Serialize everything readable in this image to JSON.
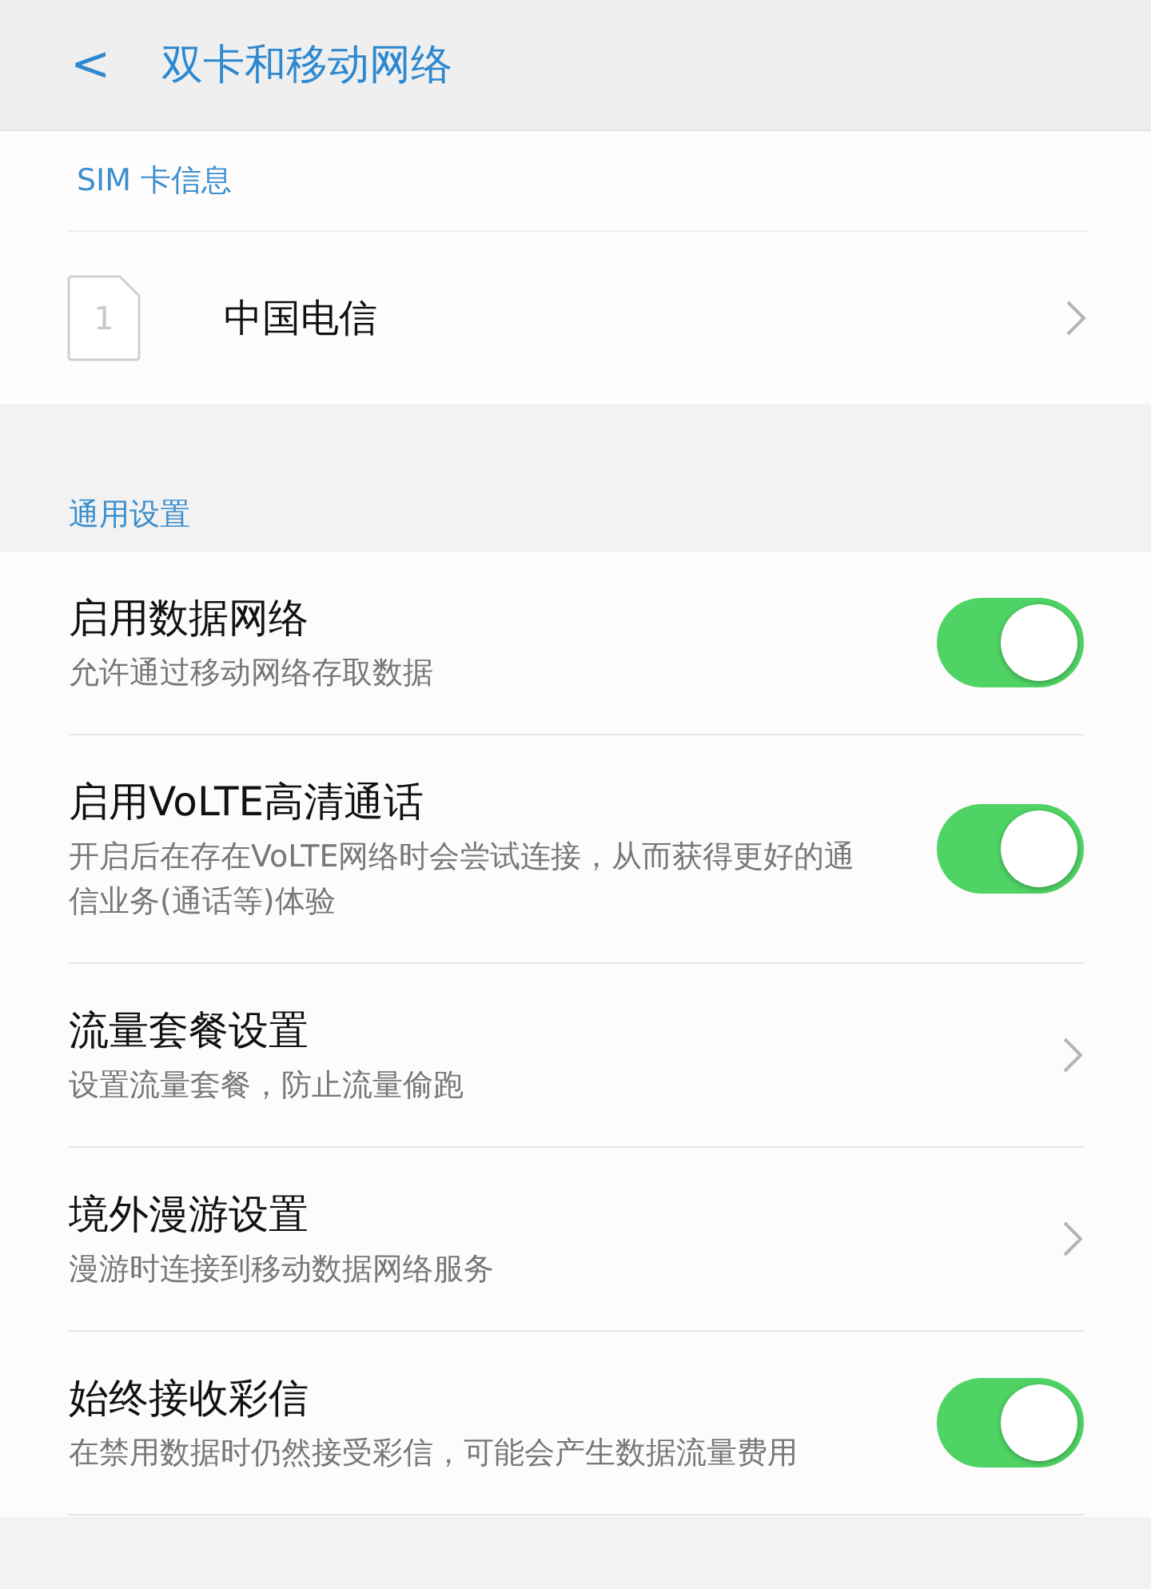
{
  "header": {
    "back_icon": "<",
    "title": "双卡和移动网络"
  },
  "sim_section": {
    "label": "SIM 卡信息",
    "sim_number": "1",
    "carrier": "中国电信"
  },
  "general_section": {
    "label": "通用设置",
    "items": [
      {
        "kind": "toggle",
        "title": "启用数据网络",
        "subtitle": "允许通过移动网络存取数据",
        "on": true
      },
      {
        "kind": "toggle",
        "title": "启用VoLTE高清通话",
        "subtitle": "开启后在存在VoLTE网络时会尝试连接，从而获得更好的通信业务(通话等)体验",
        "on": true
      },
      {
        "kind": "link",
        "title": "流量套餐设置",
        "subtitle": "设置流量套餐，防止流量偷跑"
      },
      {
        "kind": "link",
        "title": "境外漫游设置",
        "subtitle": "漫游时连接到移动数据网络服务"
      },
      {
        "kind": "toggle",
        "title": "始终接收彩信",
        "subtitle": "在禁用数据时仍然接受彩信，可能会产生数据流量费用",
        "on": true
      }
    ]
  }
}
